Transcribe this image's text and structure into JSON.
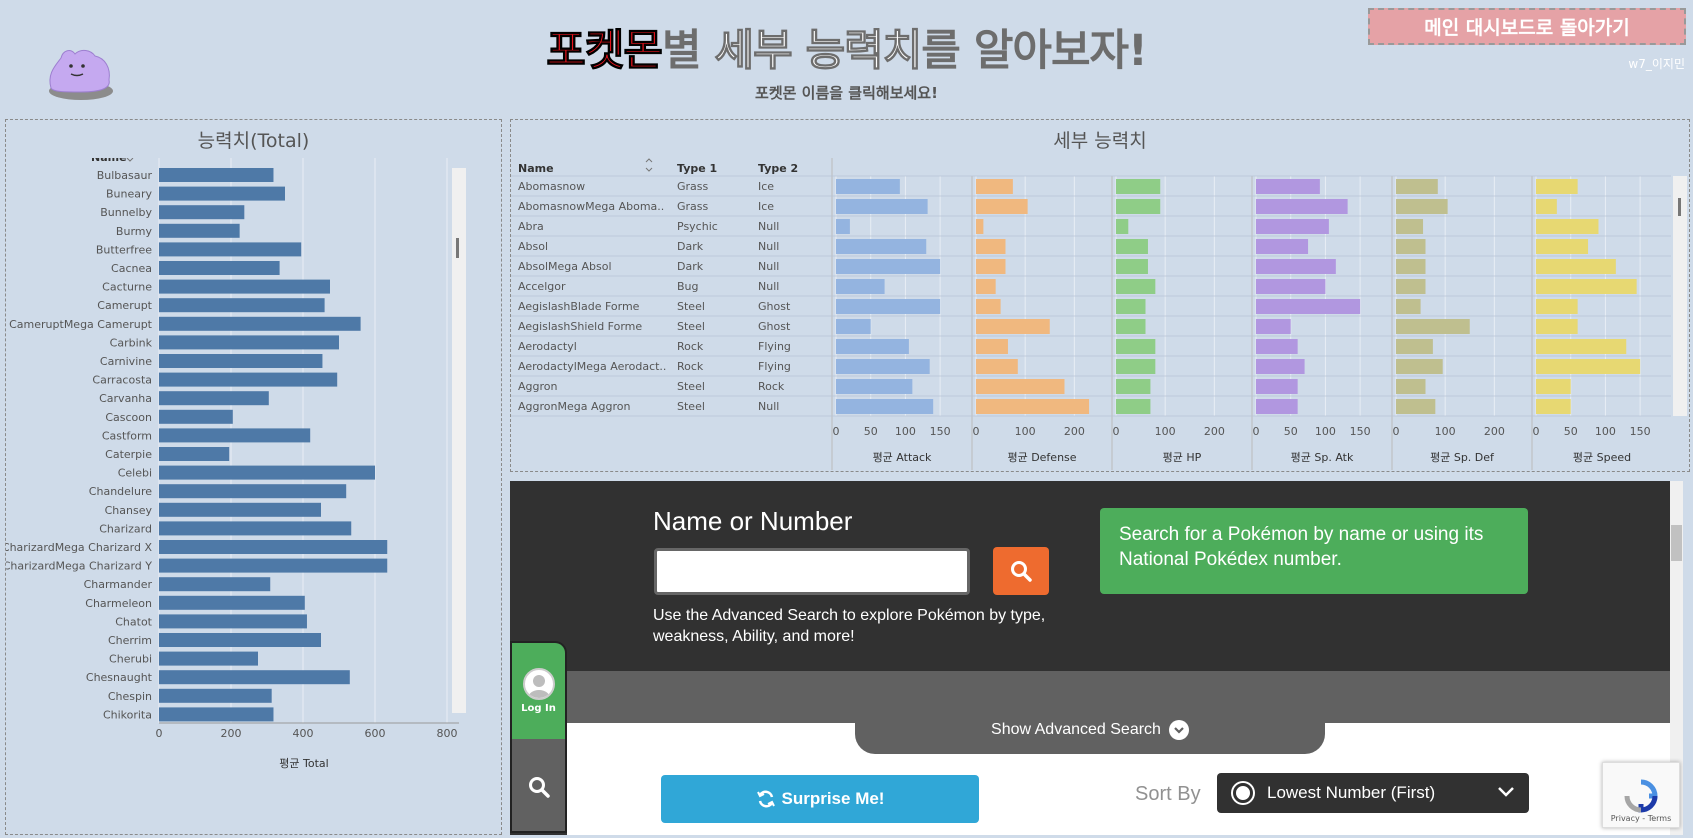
{
  "header": {
    "title_part1": "포켓몬",
    "title_part2": "별 ",
    "title_part3": "세부 능력치",
    "title_part4": "를 알아보자!",
    "subtitle": "포켓몬 이름을 클릭해보세요!",
    "back_button": "메인 대시보드로 돌아가기",
    "author": "w7_이지민"
  },
  "left_panel": {
    "title_main": "능력치",
    "title_paren": "(Total)",
    "column_header": "Name"
  },
  "right_panel": {
    "title": "세부 능력치",
    "headers": {
      "name": "Name",
      "type1": "Type 1",
      "type2": "Type 2"
    }
  },
  "chart_data": [
    {
      "type": "bar",
      "orientation": "horizontal",
      "title": "능력치(Total)",
      "xlabel": "평균 Total",
      "ylabel": "Name",
      "xlim": [
        0,
        800
      ],
      "xticks": [
        0,
        200,
        400,
        600,
        800
      ],
      "grid": true,
      "categories": [
        "Bulbasaur",
        "Buneary",
        "Bunnelby",
        "Burmy",
        "Butterfree",
        "Cacnea",
        "Cacturne",
        "Camerupt",
        "CameruptMega Camerupt",
        "Carbink",
        "Carnivine",
        "Carracosta",
        "Carvanha",
        "Cascoon",
        "Castform",
        "Caterpie",
        "Celebi",
        "Chandelure",
        "Chansey",
        "Charizard",
        "CharizardMega Charizard X",
        "CharizardMega Charizard Y",
        "Charmander",
        "Charmeleon",
        "Chatot",
        "Cherrim",
        "Cherubi",
        "Chesnaught",
        "Chespin",
        "Chikorita"
      ],
      "values": [
        318,
        350,
        237,
        224,
        395,
        335,
        475,
        460,
        560,
        500,
        454,
        495,
        305,
        205,
        420,
        195,
        600,
        520,
        450,
        534,
        634,
        634,
        309,
        405,
        411,
        450,
        275,
        530,
        313,
        318
      ],
      "color": "#4e79a7"
    },
    {
      "type": "bar",
      "orientation": "horizontal",
      "title": "세부 능력치",
      "rows": [
        {
          "name": "Abomasnow",
          "type1": "Grass",
          "type2": "Ice",
          "attack": 92,
          "defense": 75,
          "hp": 90,
          "sp_atk": 92,
          "sp_def": 85,
          "speed": 60
        },
        {
          "name": "AbomasnowMega Aboma..",
          "type1": "Grass",
          "type2": "Ice",
          "attack": 132,
          "defense": 105,
          "hp": 90,
          "sp_atk": 132,
          "sp_def": 105,
          "speed": 30
        },
        {
          "name": "Abra",
          "type1": "Psychic",
          "type2": "Null",
          "attack": 20,
          "defense": 15,
          "hp": 25,
          "sp_atk": 105,
          "sp_def": 55,
          "speed": 90
        },
        {
          "name": "Absol",
          "type1": "Dark",
          "type2": "Null",
          "attack": 130,
          "defense": 60,
          "hp": 65,
          "sp_atk": 75,
          "sp_def": 60,
          "speed": 75
        },
        {
          "name": "AbsolMega Absol",
          "type1": "Dark",
          "type2": "Null",
          "attack": 150,
          "defense": 60,
          "hp": 65,
          "sp_atk": 115,
          "sp_def": 60,
          "speed": 115
        },
        {
          "name": "Accelgor",
          "type1": "Bug",
          "type2": "Null",
          "attack": 70,
          "defense": 40,
          "hp": 80,
          "sp_atk": 100,
          "sp_def": 60,
          "speed": 145
        },
        {
          "name": "AegislashBlade Forme",
          "type1": "Steel",
          "type2": "Ghost",
          "attack": 150,
          "defense": 50,
          "hp": 60,
          "sp_atk": 150,
          "sp_def": 50,
          "speed": 60
        },
        {
          "name": "AegislashShield Forme",
          "type1": "Steel",
          "type2": "Ghost",
          "attack": 50,
          "defense": 150,
          "hp": 60,
          "sp_atk": 50,
          "sp_def": 150,
          "speed": 60
        },
        {
          "name": "Aerodactyl",
          "type1": "Rock",
          "type2": "Flying",
          "attack": 105,
          "defense": 65,
          "hp": 80,
          "sp_atk": 60,
          "sp_def": 75,
          "speed": 130
        },
        {
          "name": "AerodactylMega Aerodact..",
          "type1": "Rock",
          "type2": "Flying",
          "attack": 135,
          "defense": 85,
          "hp": 80,
          "sp_atk": 70,
          "sp_def": 95,
          "speed": 150
        },
        {
          "name": "Aggron",
          "type1": "Steel",
          "type2": "Rock",
          "attack": 110,
          "defense": 180,
          "hp": 70,
          "sp_atk": 60,
          "sp_def": 60,
          "speed": 50
        },
        {
          "name": "AggronMega Aggron",
          "type1": "Steel",
          "type2": "Null",
          "attack": 140,
          "defense": 230,
          "hp": 70,
          "sp_atk": 60,
          "sp_def": 80,
          "speed": 50
        }
      ],
      "measures": [
        {
          "key": "attack",
          "label": "평균 Attack",
          "ticks": [
            0,
            50,
            100,
            150
          ],
          "max": 170,
          "color": "#94b4e0"
        },
        {
          "key": "defense",
          "label": "평균 Defense",
          "ticks": [
            0,
            100,
            200
          ],
          "max": 240,
          "color": "#f0b87f"
        },
        {
          "key": "hp",
          "label": "평균 HP",
          "ticks": [
            0,
            100,
            200
          ],
          "max": 240,
          "color": "#8fcd87"
        },
        {
          "key": "sp_atk",
          "label": "평균 Sp. Atk",
          "ticks": [
            0,
            50,
            100,
            150
          ],
          "max": 170,
          "color": "#b197e0"
        },
        {
          "key": "sp_def",
          "label": "평균 Sp. Def",
          "ticks": [
            0,
            100,
            200
          ],
          "max": 240,
          "color": "#bfbf8f"
        },
        {
          "key": "speed",
          "label": "평균 Speed",
          "ticks": [
            0,
            50,
            100,
            150
          ],
          "max": 170,
          "color": "#e7d872"
        }
      ]
    }
  ],
  "embed": {
    "name_label": "Name or Number",
    "search_value": "",
    "advanced_text": "Use the Advanced Search to explore Pokémon by type, weakness, Ability, and more!",
    "green_box": "Search for a Pokémon by name or using its National Pokédex number.",
    "show_advanced": "Show Advanced Search",
    "surprise": "Surprise Me!",
    "sort_label": "Sort By",
    "sort_value": "Lowest Number (First)",
    "login": "Log In",
    "recaptcha": "Privacy - Terms"
  }
}
